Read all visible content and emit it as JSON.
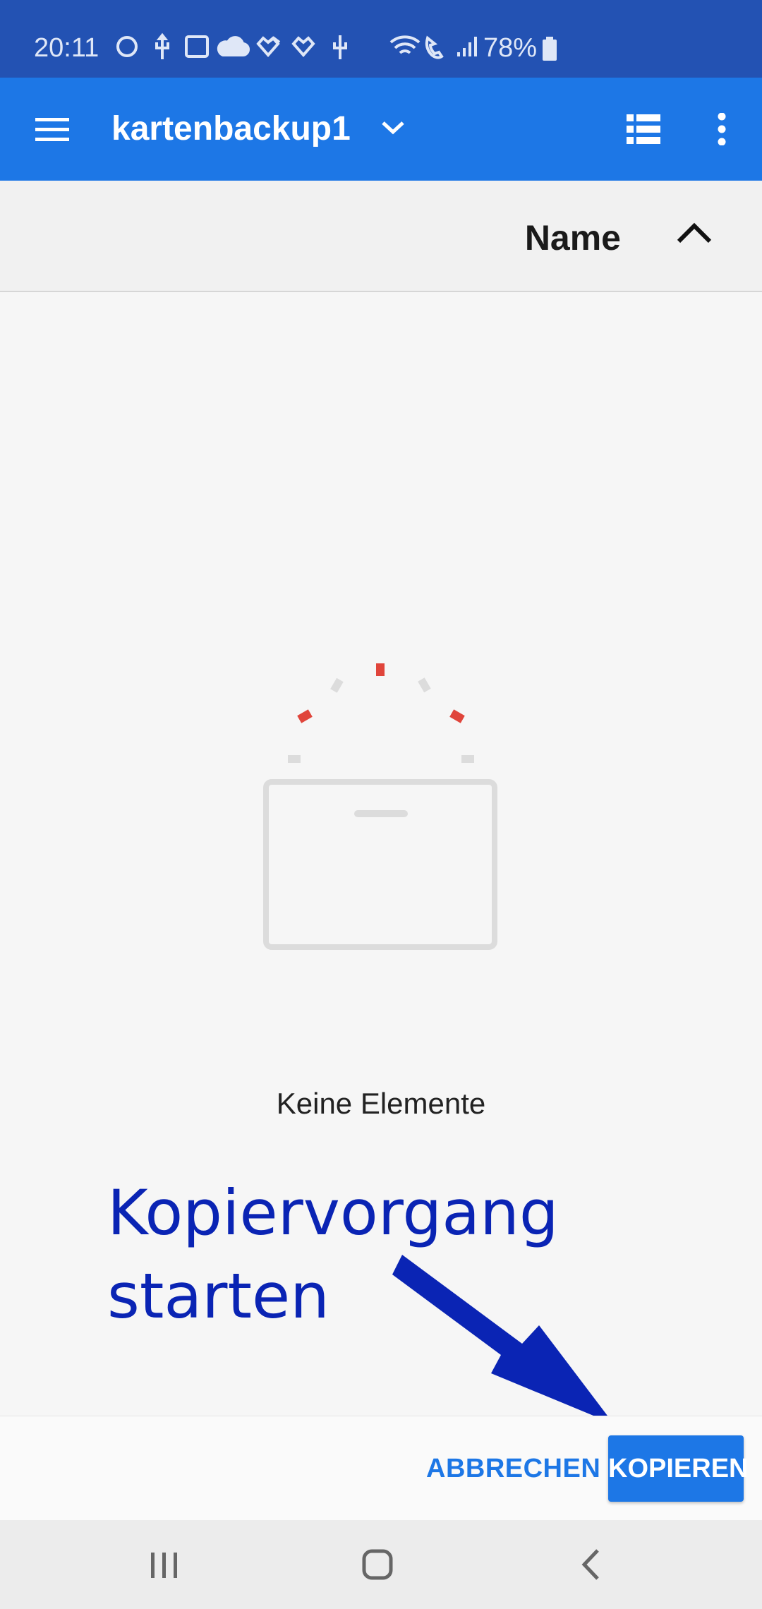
{
  "status_bar": {
    "time": "20:11",
    "battery_percent": "78%",
    "icons": [
      "alexa-ring-icon",
      "usb-icon",
      "image-icon",
      "cloud-icon",
      "health-heart-icon",
      "health-heart-icon",
      "usb-icon",
      "wifi-call-icon",
      "volte-call-icon",
      "signal-icon",
      "battery-icon"
    ]
  },
  "app_bar": {
    "title": "kartenbackup1",
    "background": "#1d77e6"
  },
  "sort_header": {
    "label": "Name",
    "direction": "ascending"
  },
  "empty_state": {
    "message": "Keine Elemente"
  },
  "annotation": {
    "line1": "Kopiervorgang",
    "line2": "starten",
    "color": "#0a24b4"
  },
  "actions": {
    "cancel_label": "ABBRECHEN",
    "copy_label": "KOPIEREN"
  },
  "nav_bar": {
    "icons": [
      "recents-icon",
      "home-icon",
      "back-icon"
    ]
  }
}
